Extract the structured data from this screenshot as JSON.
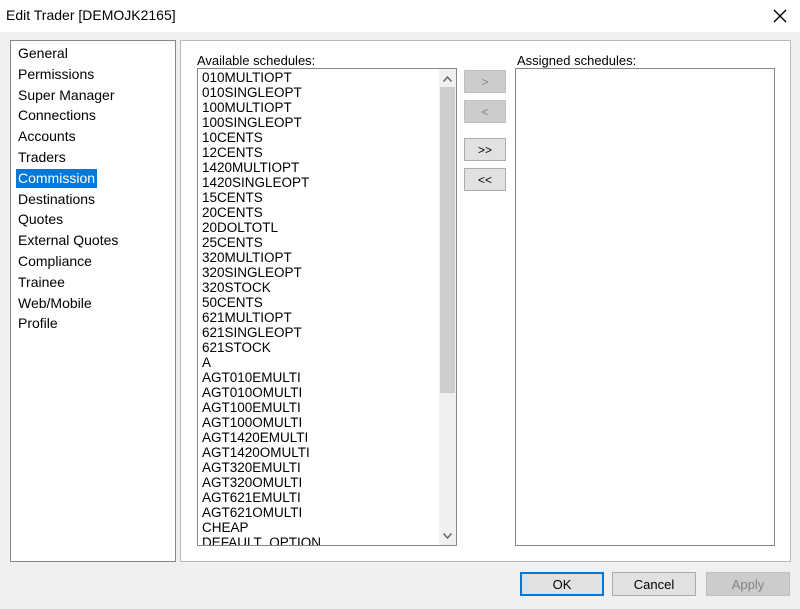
{
  "window": {
    "title": "Edit Trader [DEMOJK2165]"
  },
  "nav": {
    "items": [
      {
        "label": "General",
        "selected": false
      },
      {
        "label": "Permissions",
        "selected": false
      },
      {
        "label": "Super Manager",
        "selected": false
      },
      {
        "label": "Connections",
        "selected": false
      },
      {
        "label": "Accounts",
        "selected": false
      },
      {
        "label": "Traders",
        "selected": false
      },
      {
        "label": "Commission",
        "selected": true
      },
      {
        "label": "Destinations",
        "selected": false
      },
      {
        "label": "Quotes",
        "selected": false
      },
      {
        "label": "External Quotes",
        "selected": false
      },
      {
        "label": "Compliance",
        "selected": false
      },
      {
        "label": "Trainee",
        "selected": false
      },
      {
        "label": "Web/Mobile",
        "selected": false
      },
      {
        "label": "Profile",
        "selected": false
      }
    ]
  },
  "available": {
    "label": "Available schedules:",
    "items": [
      "010MULTIOPT",
      "010SINGLEOPT",
      "100MULTIOPT",
      "100SINGLEOPT",
      "10CENTS",
      "12CENTS",
      "1420MULTIOPT",
      "1420SINGLEOPT",
      "15CENTS",
      "20CENTS",
      "20DOLTOTL",
      "25CENTS",
      "320MULTIOPT",
      "320SINGLEOPT",
      "320STOCK",
      "50CENTS",
      "621MULTIOPT",
      "621SINGLEOPT",
      "621STOCK",
      "A",
      "AGT010EMULTI",
      "AGT010OMULTI",
      "AGT100EMULTI",
      "AGT100OMULTI",
      "AGT1420EMULTI",
      "AGT1420OMULTI",
      "AGT320EMULTI",
      "AGT320OMULTI",
      "AGT621EMULTI",
      "AGT621OMULTI",
      "CHEAP",
      "DEFAULT_OPTION"
    ]
  },
  "assigned": {
    "label": "Assigned schedules:",
    "items": []
  },
  "move_buttons": {
    "add": ">",
    "remove": "<",
    "add_all": ">>",
    "remove_all": "<<"
  },
  "footer": {
    "ok": "OK",
    "cancel": "Cancel",
    "apply": "Apply"
  },
  "colors": {
    "selection": "#0078d7",
    "default_button_border": "#0078d7"
  }
}
